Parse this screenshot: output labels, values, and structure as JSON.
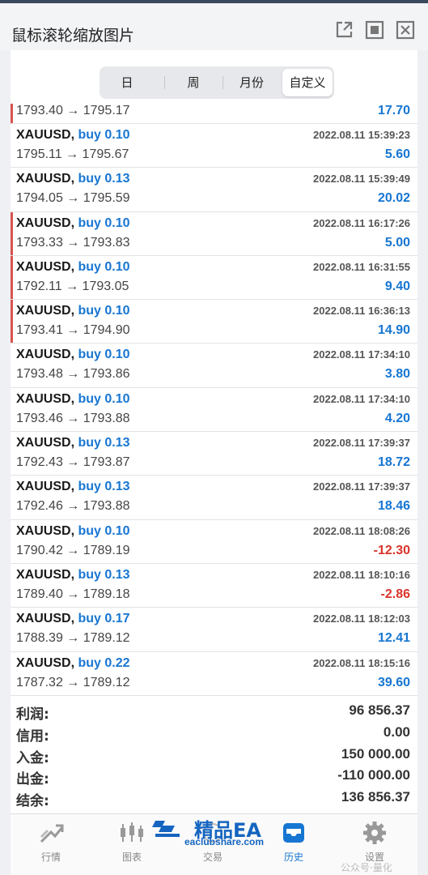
{
  "window": {
    "title": "鼠标滚轮缩放图片"
  },
  "period_tabs": [
    "日",
    "周",
    "月份",
    "自定义"
  ],
  "period_active": "自定义",
  "first_partial": {
    "prices": "1793.40 → 1795.17",
    "profit": "17.70",
    "marked": true
  },
  "deals": [
    {
      "symbol": "XAUUSD,",
      "dir": "buy 0.10",
      "time": "2022.08.11 15:39:23",
      "prices": "1795.11 → 1795.67",
      "profit": "5.60",
      "neg": false,
      "marked": false
    },
    {
      "symbol": "XAUUSD,",
      "dir": "buy 0.13",
      "time": "2022.08.11 15:39:49",
      "prices": "1794.05 → 1795.59",
      "profit": "20.02",
      "neg": false,
      "marked": false
    },
    {
      "symbol": "XAUUSD,",
      "dir": "buy 0.10",
      "time": "2022.08.11 16:17:26",
      "prices": "1793.33 → 1793.83",
      "profit": "5.00",
      "neg": false,
      "marked": true
    },
    {
      "symbol": "XAUUSD,",
      "dir": "buy 0.10",
      "time": "2022.08.11 16:31:55",
      "prices": "1792.11 → 1793.05",
      "profit": "9.40",
      "neg": false,
      "marked": true
    },
    {
      "symbol": "XAUUSD,",
      "dir": "buy 0.10",
      "time": "2022.08.11 16:36:13",
      "prices": "1793.41 → 1794.90",
      "profit": "14.90",
      "neg": false,
      "marked": true
    },
    {
      "symbol": "XAUUSD,",
      "dir": "buy 0.10",
      "time": "2022.08.11 17:34:10",
      "prices": "1793.48 → 1793.86",
      "profit": "3.80",
      "neg": false,
      "marked": false
    },
    {
      "symbol": "XAUUSD,",
      "dir": "buy 0.10",
      "time": "2022.08.11 17:34:10",
      "prices": "1793.46 → 1793.88",
      "profit": "4.20",
      "neg": false,
      "marked": false
    },
    {
      "symbol": "XAUUSD,",
      "dir": "buy 0.13",
      "time": "2022.08.11 17:39:37",
      "prices": "1792.43 → 1793.87",
      "profit": "18.72",
      "neg": false,
      "marked": false
    },
    {
      "symbol": "XAUUSD,",
      "dir": "buy 0.13",
      "time": "2022.08.11 17:39:37",
      "prices": "1792.46 → 1793.88",
      "profit": "18.46",
      "neg": false,
      "marked": false
    },
    {
      "symbol": "XAUUSD,",
      "dir": "buy 0.10",
      "time": "2022.08.11 18:08:26",
      "prices": "1790.42 → 1789.19",
      "profit": "-12.30",
      "neg": true,
      "marked": false
    },
    {
      "symbol": "XAUUSD,",
      "dir": "buy 0.13",
      "time": "2022.08.11 18:10:16",
      "prices": "1789.40 → 1789.18",
      "profit": "-2.86",
      "neg": true,
      "marked": false
    },
    {
      "symbol": "XAUUSD,",
      "dir": "buy 0.17",
      "time": "2022.08.11 18:12:03",
      "prices": "1788.39 → 1789.12",
      "profit": "12.41",
      "neg": false,
      "marked": false
    },
    {
      "symbol": "XAUUSD,",
      "dir": "buy 0.22",
      "time": "2022.08.11 18:15:16",
      "prices": "1787.32 → 1789.12",
      "profit": "39.60",
      "neg": false,
      "marked": false
    }
  ],
  "summary": [
    {
      "label": "利润:",
      "value": "96 856.37"
    },
    {
      "label": "信用:",
      "value": "0.00"
    },
    {
      "label": "入金:",
      "value": "150 000.00"
    },
    {
      "label": "出金:",
      "value": "-110 000.00"
    },
    {
      "label": "结余:",
      "value": "136 856.37"
    }
  ],
  "bottom_tabs": [
    {
      "label": "行情",
      "icon": "quotes-icon",
      "active": false
    },
    {
      "label": "图表",
      "icon": "chart-icon",
      "active": false
    },
    {
      "label": "交易",
      "icon": "trade-icon",
      "active": false
    },
    {
      "label": "历史",
      "icon": "history-icon",
      "active": true
    },
    {
      "label": "设置",
      "icon": "settings-icon",
      "active": false
    }
  ],
  "watermark": {
    "brand": "精品EA",
    "url": "eaclubshare.com",
    "corner": "公众号·量化"
  },
  "colors": {
    "accent_blue": "#1776d2",
    "negative_red": "#d9342b",
    "marker_red": "#d9534f"
  }
}
